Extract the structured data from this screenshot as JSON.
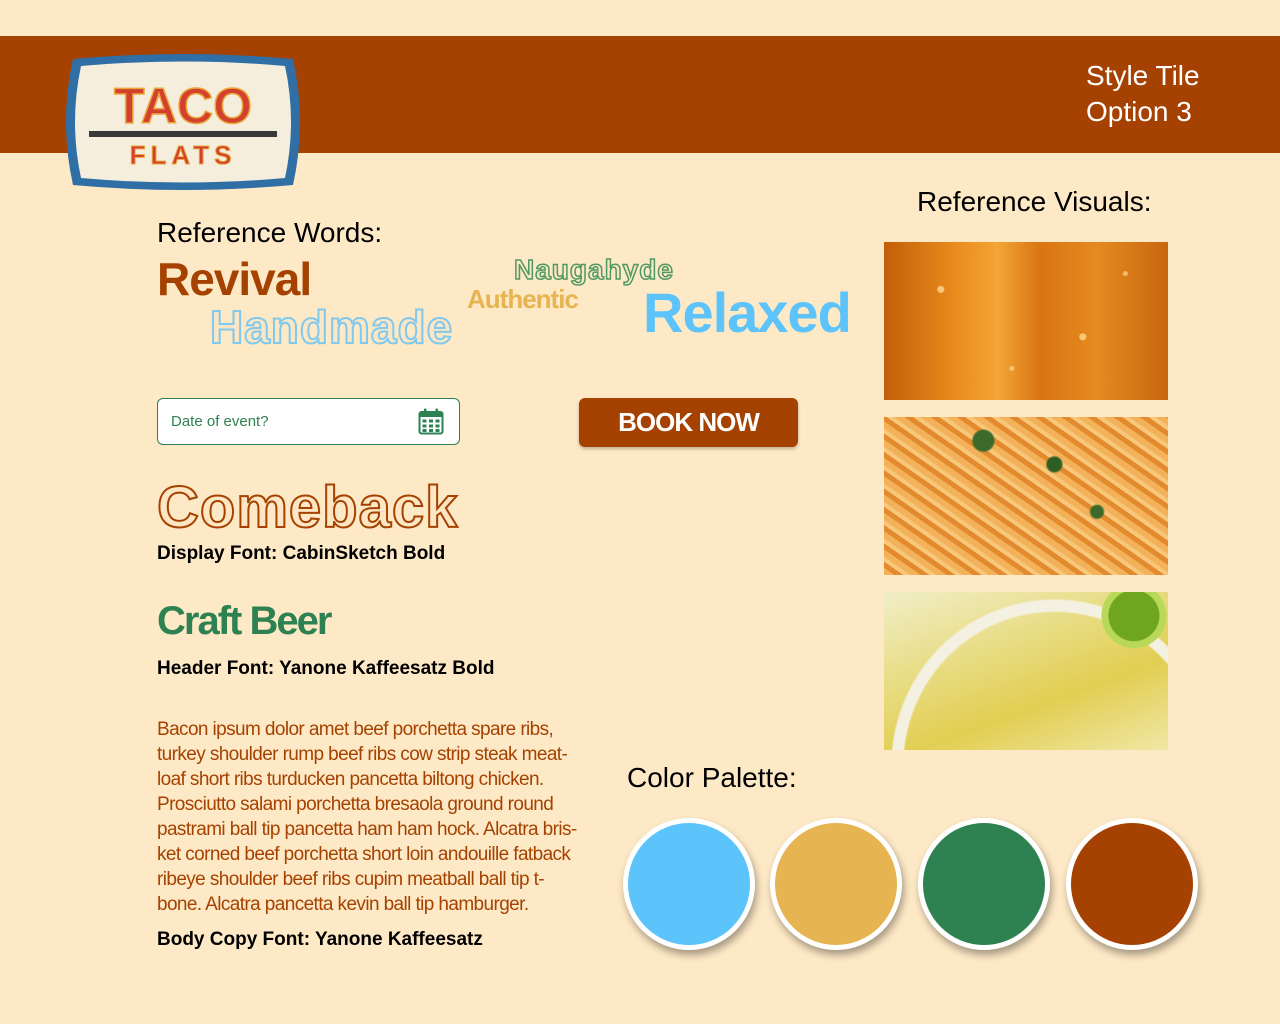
{
  "header": {
    "title_line1": "Style Tile",
    "title_line2": "Option 3",
    "logo_text_top": "TACO",
    "logo_text_bottom": "FLATS"
  },
  "reference_words": {
    "heading": "Reference Words:",
    "words": [
      "Revival",
      "Handmade",
      "Authentic",
      "Naugahyde",
      "Relaxed"
    ]
  },
  "form": {
    "date_placeholder": "Date of event?",
    "book_button_label": "BOOK NOW"
  },
  "typography": {
    "display_sample": "Comeback",
    "display_caption": "Display Font: CabinSketch Bold",
    "header_sample": "Craft Beer",
    "header_caption": "Header Font: Yanone Kaffeesatz Bold",
    "body_copy": "Bacon ipsum dolor amet beef porchetta spare ribs, turkey shoulder rump beef ribs cow strip steak meat-loaf short ribs turducken pancetta biltong chicken. Prosciutto salami porchetta bresaola ground round pastrami ball tip pancetta ham ham hock. Alcatra bris-ket corned beef porchetta short loin andouille fatback ribeye shoulder beef ribs cupim meatball ball tip t-bone. Alcatra pancetta kevin ball tip hamburger.",
    "body_caption": "Body Copy Font: Yanone Kaffeesatz"
  },
  "reference_visuals": {
    "heading": "Reference Visuals:"
  },
  "palette": {
    "heading": "Color Palette:",
    "colors": [
      "#5CC3FB",
      "#E6B450",
      "#2E8150",
      "#A54201"
    ]
  },
  "colors": {
    "background": "#FEE9C6",
    "brand_brown": "#A54201",
    "green": "#2E8150",
    "blue": "#5CC3FB",
    "gold": "#E6B450"
  }
}
